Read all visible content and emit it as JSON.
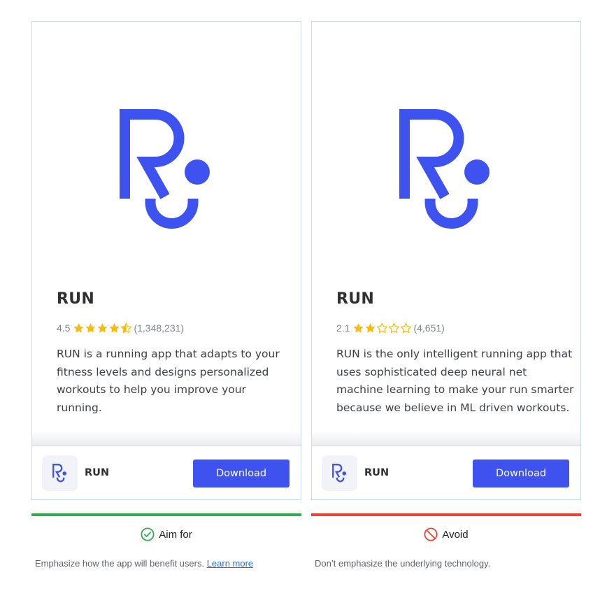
{
  "colors": {
    "brand_blue": "#3d52ef",
    "star_gold": "#fbbc04",
    "aim_green": "#34a853",
    "avoid_red": "#ea4335",
    "card_border": "#c6dcf0"
  },
  "panels": [
    {
      "verdict": "Aim for",
      "verdict_icon": "check-circle-icon",
      "card": {
        "logo_icon": "run-logo-icon",
        "app_title": "RUN",
        "rating_value": "4.5",
        "stars": [
          "full",
          "full",
          "full",
          "full",
          "half"
        ],
        "rating_count": "(1,348,231)",
        "description": "RUN is a running app that adapts to your fitness levels and designs personalized workouts to help you improve your running.",
        "bar_name": "RUN",
        "download_label": "Download"
      },
      "caption": "Emphasize how the app will benefit users. ",
      "caption_link": "Learn more"
    },
    {
      "verdict": "Avoid",
      "verdict_icon": "prohibited-icon",
      "card": {
        "logo_icon": "run-logo-icon",
        "app_title": "RUN",
        "rating_value": "2.1",
        "stars": [
          "full",
          "full",
          "empty",
          "empty",
          "empty"
        ],
        "rating_count": "(4,651)",
        "description": "RUN is the only intelligent running app that uses sophisticated deep neural net machine learning to make your run smarter because we believe in ML driven workouts.",
        "bar_name": "RUN",
        "download_label": "Download"
      },
      "caption": "Don’t emphasize the underlying technology."
    }
  ]
}
